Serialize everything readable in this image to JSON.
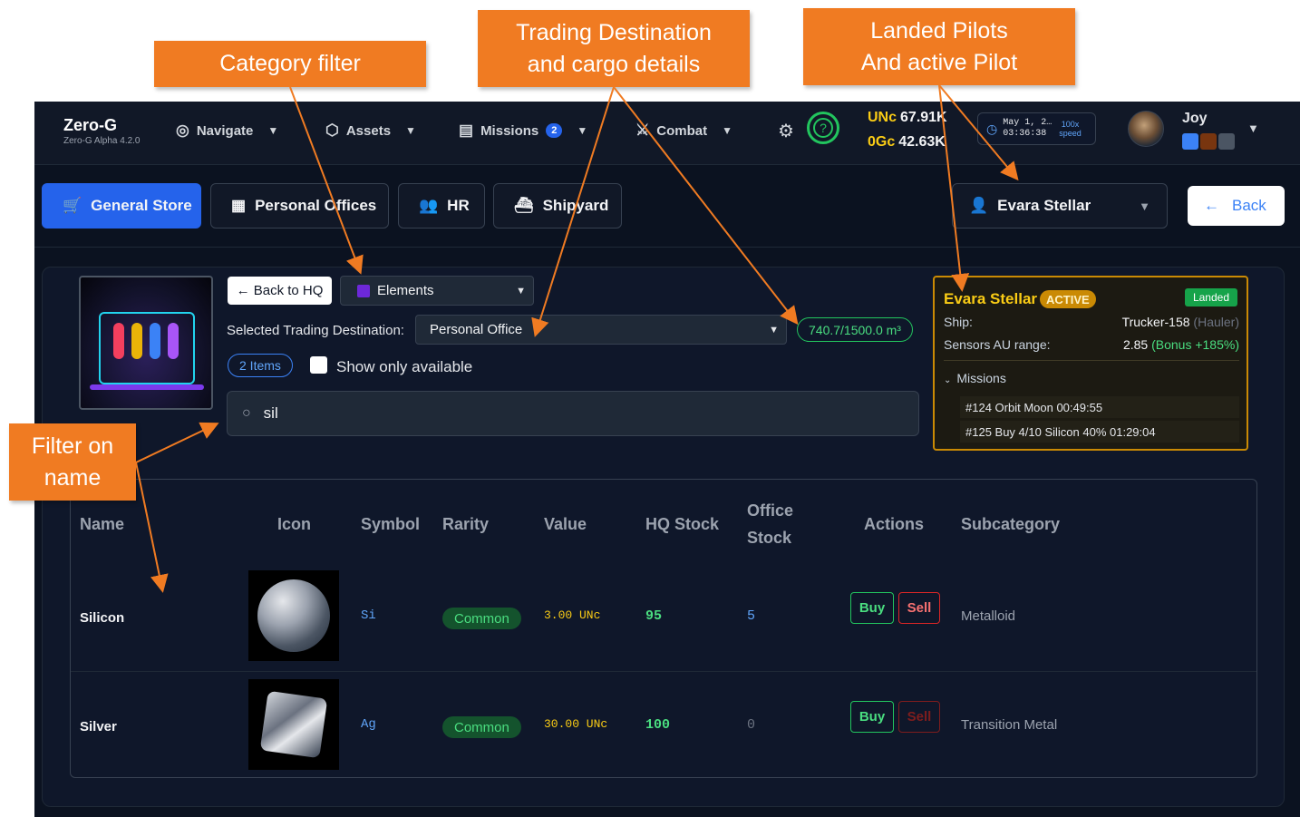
{
  "header": {
    "app_title": "Zero-G",
    "app_version": "Zero-G Alpha 4.2.0",
    "nav": [
      {
        "label": "Navigate",
        "icon": "globe-icon"
      },
      {
        "label": "Assets",
        "icon": "cube-icon"
      },
      {
        "label": "Missions",
        "icon": "scroll-icon",
        "badge": "2"
      },
      {
        "label": "Combat",
        "icon": "swords-icon"
      }
    ],
    "currencies": [
      {
        "code": "UNc",
        "amount": "67.91K"
      },
      {
        "code": "0Gc",
        "amount": "42.63K"
      }
    ],
    "clock": {
      "date": "May 1, 2…",
      "time": "03:36:38",
      "speed_value": "100x",
      "speed_label": "speed"
    },
    "user": {
      "name": "Joy"
    }
  },
  "tabs": [
    {
      "label": "General Store",
      "icon": "cart-icon",
      "active": true
    },
    {
      "label": "Personal Offices",
      "icon": "building-icon"
    },
    {
      "label": "HR",
      "icon": "people-icon"
    },
    {
      "label": "Shipyard",
      "icon": "ship-icon"
    }
  ],
  "pilot_select": {
    "value": "Evara Stellar"
  },
  "back_button": {
    "label": "Back"
  },
  "store": {
    "back_hq_label": "← Back to HQ",
    "category": "Elements",
    "dest_label": "Selected Trading Destination:",
    "dest_value": "Personal Office",
    "cargo": "740.7/1500.0 m³",
    "items_count": "2 Items",
    "show_available_label": "Show only available",
    "search_value": "sil"
  },
  "pilot_card": {
    "name": "Evara Stellar",
    "status": "ACTIVE",
    "landed": "Landed",
    "ship_label": "Ship:",
    "ship_value": "Trucker-158",
    "ship_class": "(Hauler)",
    "sensors_label": "Sensors AU range:",
    "sensors_value": "2.85",
    "sensors_bonus": "(Bonus +185%)",
    "missions_label": "Missions",
    "missions": [
      "#124 Orbit Moon 00:49:55",
      "#125 Buy 4/10 Silicon 40% 01:29:04"
    ]
  },
  "table": {
    "columns": [
      "Name",
      "Icon",
      "Symbol",
      "Rarity",
      "Value",
      "HQ Stock",
      "Office Stock",
      "Actions",
      "Subcategory"
    ],
    "buy_label": "Buy",
    "sell_label": "Sell",
    "rows": [
      {
        "name": "Silicon",
        "symbol": "Si",
        "rarity": "Common",
        "value": "3.00 UNc",
        "hq_stock": "95",
        "office_stock": "5",
        "subcategory": "Metalloid",
        "sell_enabled": true
      },
      {
        "name": "Silver",
        "symbol": "Ag",
        "rarity": "Common",
        "value": "30.00 UNc",
        "hq_stock": "100",
        "office_stock": "0",
        "subcategory": "Transition Metal",
        "sell_enabled": false
      }
    ]
  },
  "annotations": {
    "category_filter": "Category filter",
    "trading_destination": [
      "Trading Destination",
      "and cargo details"
    ],
    "landed_pilots": [
      "Landed Pilots",
      "And active Pilot"
    ],
    "filter_name": [
      "Filter on",
      "name"
    ]
  },
  "colors": {
    "accent": "#2563eb",
    "callout": "#f07b22",
    "active_pilot": "#facc15",
    "success": "#22c55e"
  }
}
